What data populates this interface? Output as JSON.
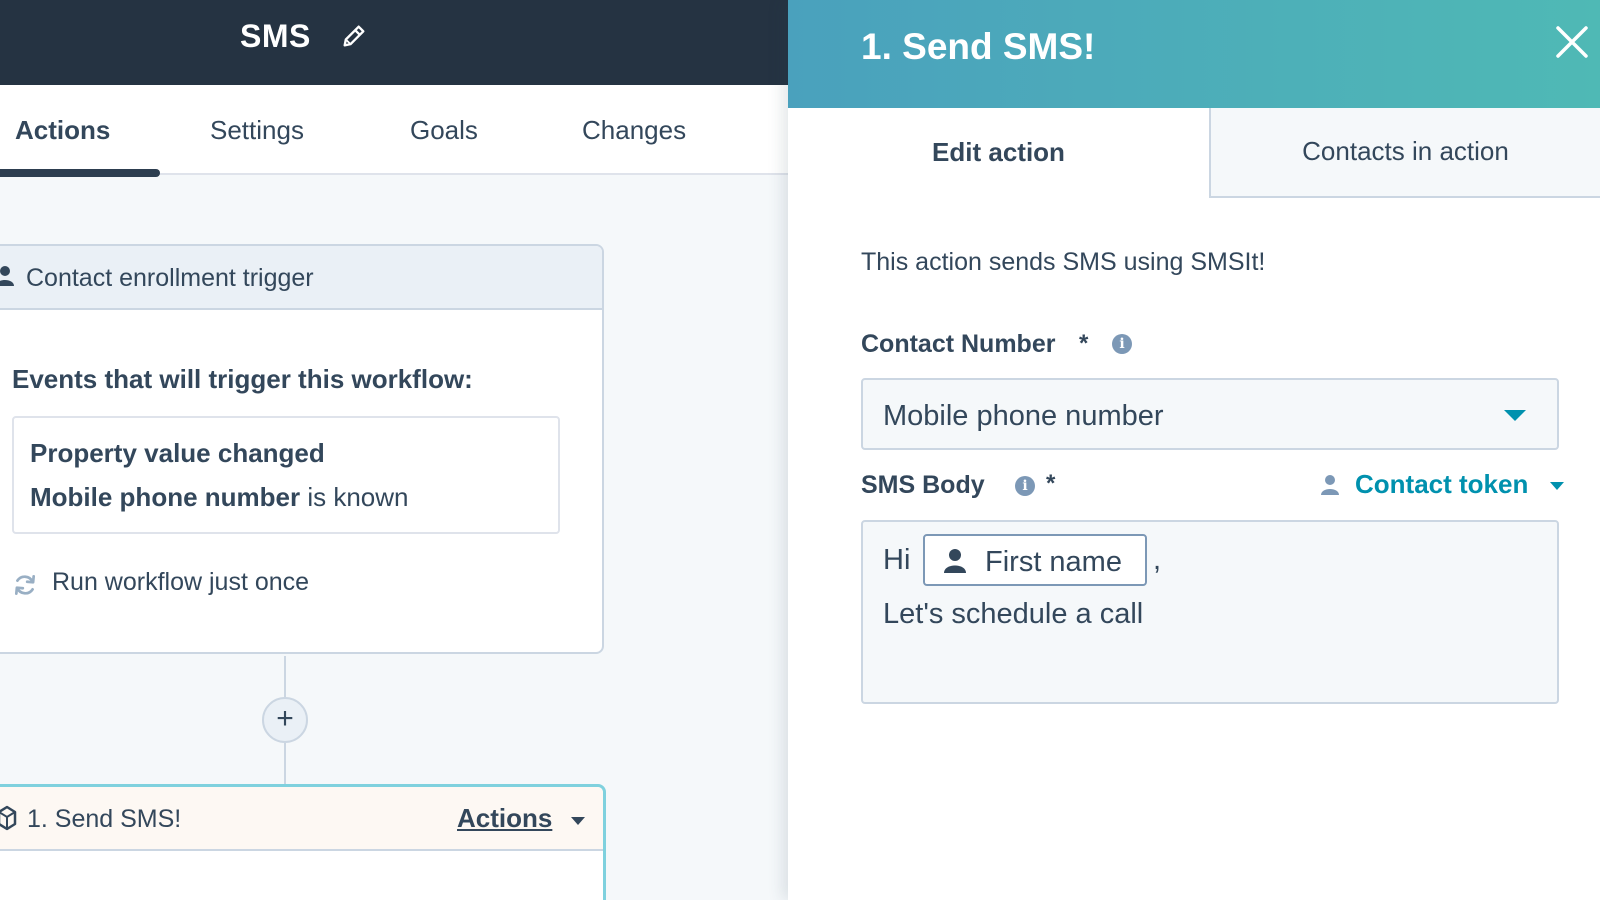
{
  "workflow": {
    "title": "SMS"
  },
  "tabs": [
    {
      "label": "Actions",
      "active": true
    },
    {
      "label": "Settings",
      "active": false
    },
    {
      "label": "Goals",
      "active": false
    },
    {
      "label": "Changes",
      "active": false
    }
  ],
  "trigger_card": {
    "header": "Contact enrollment trigger",
    "events_heading": "Events that will trigger this workflow:",
    "filter": {
      "line1": "Property value changed",
      "property": "Mobile phone number",
      "condition": "is known"
    },
    "rerun": "Run workflow just once"
  },
  "add_button": "+",
  "action_card": {
    "label": "1. Send SMS!",
    "menu": "Actions"
  },
  "panel": {
    "title": "1. Send SMS!",
    "tabs": [
      {
        "label": "Edit action",
        "active": true
      },
      {
        "label": "Contacts in action",
        "active": false
      }
    ],
    "description": "This action sends SMS using SMSIt!",
    "contact_number": {
      "label": "Contact Number",
      "required": "*",
      "info": "i",
      "value": "Mobile phone number"
    },
    "sms_body": {
      "label": "SMS Body",
      "required": "*",
      "info": "i",
      "token_menu": "Contact token",
      "greeting": "Hi",
      "token": "First name",
      "comma": ",",
      "line2": "Let's schedule a call"
    }
  },
  "colors": {
    "topbar": "#253342",
    "text": "#33475b",
    "accent": "#0091ae",
    "panel_header_start": "#4aa1bd",
    "panel_header_end": "#4fb9b5",
    "border": "#cbd6e2"
  }
}
